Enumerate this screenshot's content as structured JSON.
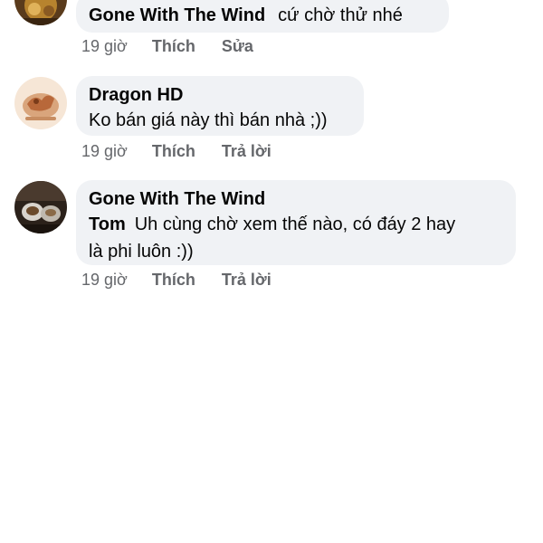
{
  "comments": [
    {
      "author": "Gone With The Wind",
      "text": "cứ chờ thử nhé",
      "time": "19 giờ",
      "like_label": "Thích",
      "secondary_action": "Sửa"
    },
    {
      "author": "Dragon HD",
      "text": "Ko bán giá này thì bán nhà ;))",
      "time": "19 giờ",
      "like_label": "Thích",
      "secondary_action": "Trả lời"
    },
    {
      "author": "Gone With The Wind",
      "mention": "Tom",
      "text_line1": "Uh cùng chờ xem thế nào, có đáy 2 hay",
      "text_line2": "là phi luôn :))",
      "time": "19 giờ",
      "like_label": "Thích",
      "secondary_action": "Trả lời"
    }
  ],
  "colors": {
    "bubble_bg": "#f0f2f5",
    "meta_text": "#65676b",
    "primary_text": "#050505"
  }
}
